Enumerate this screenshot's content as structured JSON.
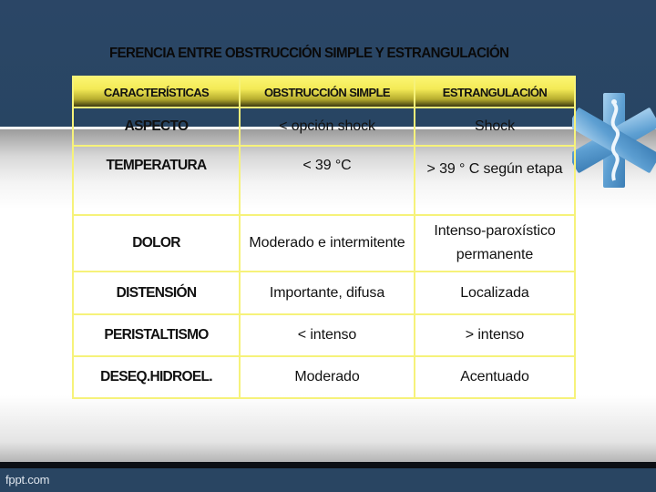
{
  "slide": {
    "title": "FERENCIA ENTRE OBSTRUCCIÓN SIMPLE Y ESTRANGULACIÓN",
    "footer": "fppt.com",
    "decoration_icon": "star-of-life-icon"
  },
  "table": {
    "headers": [
      "CARACTERÍSTICAS",
      "OBSTRUCCIÓN SIMPLE",
      "ESTRANGULACIÓN"
    ],
    "rows": [
      {
        "label": "ASPECTO",
        "simple": "< opción shock",
        "estrang": "Shock"
      },
      {
        "label": "TEMPERATURA",
        "simple": "< 39 °C",
        "estrang": "> 39 ° C según etapa"
      },
      {
        "label": "DOLOR",
        "simple": "Moderado e intermitente",
        "estrang": "Intenso-paroxístico permanente"
      },
      {
        "label": "DISTENSIÓN",
        "simple": "Importante, difusa",
        "estrang": "Localizada"
      },
      {
        "label": "PERISTALTISMO",
        "simple": "< intenso",
        "estrang": "> intenso"
      },
      {
        "label": "DESEQ.HIDROEL.",
        "simple": "Moderado",
        "estrang": "Acentuado"
      }
    ]
  },
  "colors": {
    "header_yellow": "#f3ea56",
    "grid_line": "#f6f27a",
    "background_blue": "#2b4666"
  }
}
